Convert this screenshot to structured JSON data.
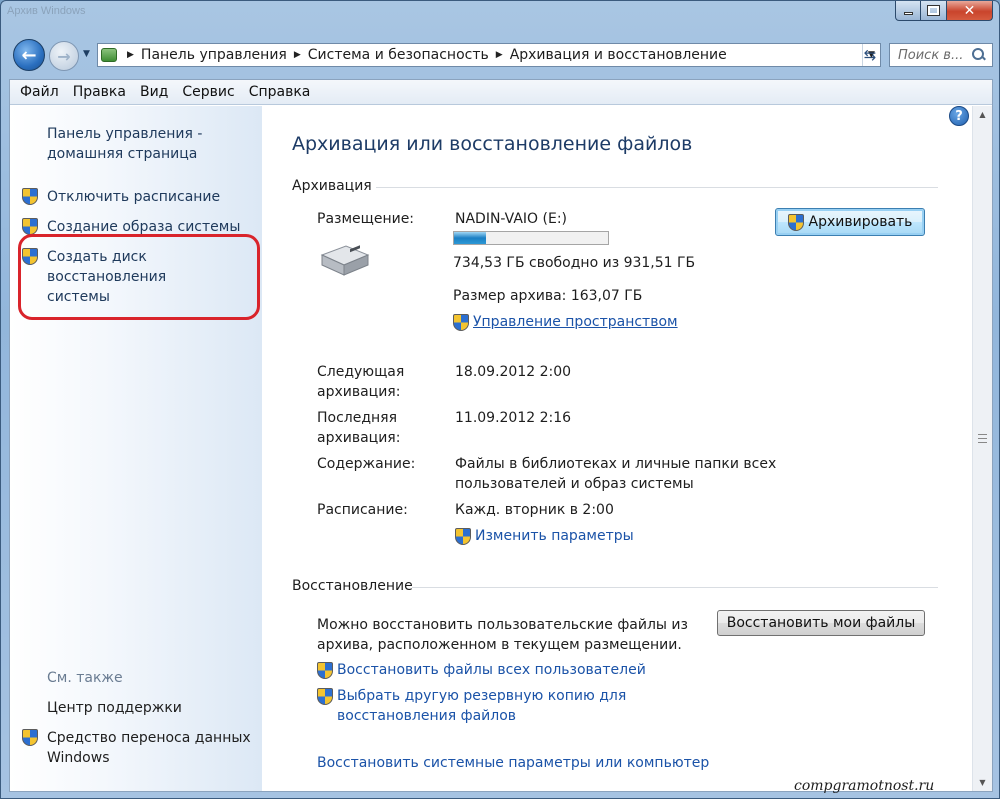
{
  "window": {
    "ghost_title": "Архив Windows",
    "controls": {
      "minimize": "–",
      "maximize": "□",
      "close": "✕"
    }
  },
  "nav": {
    "back_icon": "←",
    "forward_icon": "→",
    "breadcrumbs": [
      "Панель управления",
      "Система и безопасность",
      "Архивация и восстановление"
    ],
    "search_placeholder": "Поиск в..."
  },
  "menu": [
    "Файл",
    "Правка",
    "Вид",
    "Сервис",
    "Справка"
  ],
  "sidebar": {
    "home_line1": "Панель управления -",
    "home_line2": "домашняя страница",
    "tasks": [
      {
        "label": "Отключить расписание",
        "icon": "shield-icon"
      },
      {
        "label": "Создание образа системы",
        "icon": "shield-icon"
      },
      {
        "label_line1": "Создать диск восстановления",
        "label_line2": "системы",
        "icon": "shield-icon"
      }
    ],
    "see_also": "См. также",
    "links": [
      {
        "label": "Центр поддержки"
      },
      {
        "label_line1": "Средство переноса данных",
        "label_line2": "Windows",
        "icon": "shield-icon"
      }
    ]
  },
  "main": {
    "title": "Архивация или восстановление файлов",
    "backup": {
      "section": "Архивация",
      "location_label": "Размещение:",
      "drive_name": "NADIN-VAIO (E:)",
      "free_text": "734,53 ГБ свободно из 931,51 ГБ",
      "used_fraction": 0.21,
      "archive_size": "Размер архива: 163,07 ГБ",
      "manage_space": "Управление пространством",
      "backup_button": "Архивировать",
      "next_label_1": "Следующая",
      "next_label_2": "архивация:",
      "next_value": "18.09.2012 2:00",
      "last_label_1": "Последняя",
      "last_label_2": "архивация:",
      "last_value": "11.09.2012 2:16",
      "contents_label": "Содержание:",
      "contents_value_1": "Файлы в библиотеках и личные папки всех",
      "contents_value_2": "пользователей и образ системы",
      "schedule_label": "Расписание:",
      "schedule_value": "Кажд. вторник в 2:00",
      "change_settings": "Изменить параметры"
    },
    "restore": {
      "section": "Восстановление",
      "desc_1": "Можно восстановить пользовательские файлы из",
      "desc_2": "архива, расположенном в текущем размещении.",
      "restore_button": "Восстановить мои файлы",
      "restore_all": "Восстановить файлы всех пользователей",
      "select_other_1": "Выбрать другую резервную копию для",
      "select_other_2": "восстановления файлов",
      "restore_system": "Восстановить системные параметры или компьютер"
    },
    "watermark": "compgramotnost.ru"
  },
  "colors": {
    "link": "#1b53a8",
    "nav_link": "#1e395b",
    "title": "#1d3b66",
    "highlight": "#d9242b"
  }
}
